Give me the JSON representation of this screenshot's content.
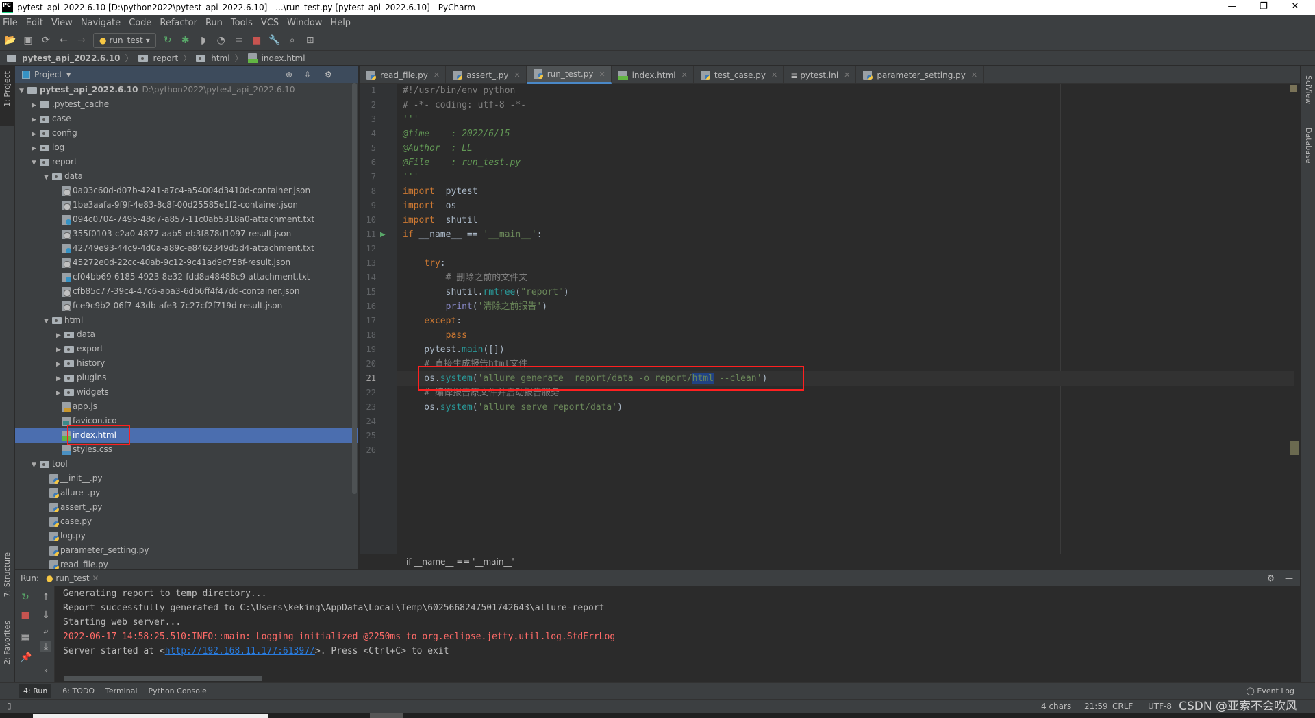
{
  "window": {
    "title": "pytest_api_2022.6.10 [D:\\python2022\\pytest_api_2022.6.10] - ...\\run_test.py [pytest_api_2022.6.10] - PyCharm",
    "logo": "PC"
  },
  "menu": [
    "File",
    "Edit",
    "View",
    "Navigate",
    "Code",
    "Refactor",
    "Run",
    "Tools",
    "VCS",
    "Window",
    "Help"
  ],
  "toolbar": {
    "run_config": "run_test"
  },
  "breadcrumb": [
    "pytest_api_2022.6.10",
    "report",
    "html",
    "index.html"
  ],
  "left_strip": {
    "project": "1: Project",
    "structure": "7: Structure",
    "favorites": "2: Favorites"
  },
  "right_strip": {
    "sciview": "SciView",
    "database": "Database"
  },
  "project": {
    "header": "Project",
    "tree": [
      {
        "label": "pytest_api_2022.6.10",
        "path": "D:\\python2022\\pytest_api_2022.6.10",
        "depth": 0,
        "type": "root",
        "open": true
      },
      {
        "label": ".pytest_cache",
        "depth": 1,
        "type": "folder",
        "open": false
      },
      {
        "label": "case",
        "depth": 1,
        "type": "folder",
        "open": false
      },
      {
        "label": "config",
        "depth": 1,
        "type": "folder",
        "open": false
      },
      {
        "label": "log",
        "depth": 1,
        "type": "folder",
        "open": false
      },
      {
        "label": "report",
        "depth": 1,
        "type": "folder",
        "open": true
      },
      {
        "label": "data",
        "depth": 2,
        "type": "folder",
        "open": true
      },
      {
        "label": "0a03c60d-d07b-4241-a7c4-a54004d3410d-container.json",
        "depth": 3,
        "type": "json"
      },
      {
        "label": "1be3aafa-9f9f-4e83-8c8f-00d25585e1f2-container.json",
        "depth": 3,
        "type": "json"
      },
      {
        "label": "094c0704-7495-48d7-a857-11c0ab5318a0-attachment.txt",
        "depth": 3,
        "type": "txt"
      },
      {
        "label": "355f0103-c2a0-4877-aab5-eb3f878d1097-result.json",
        "depth": 3,
        "type": "json"
      },
      {
        "label": "42749e93-44c9-4d0a-a89c-e8462349d5d4-attachment.txt",
        "depth": 3,
        "type": "txt"
      },
      {
        "label": "45272e0d-22cc-40ab-9c12-9c41ad9c758f-result.json",
        "depth": 3,
        "type": "json"
      },
      {
        "label": "cf04bb69-6185-4923-8e32-fdd8a48488c9-attachment.txt",
        "depth": 3,
        "type": "txt"
      },
      {
        "label": "cfb85c77-39c4-47c6-aba3-6db6ff4f47dd-container.json",
        "depth": 3,
        "type": "json"
      },
      {
        "label": "fce9c9b2-06f7-43db-afe3-7c27cf2f719d-result.json",
        "depth": 3,
        "type": "json"
      },
      {
        "label": "html",
        "depth": 2,
        "type": "folder",
        "open": true
      },
      {
        "label": "data",
        "depth": 3,
        "type": "folder",
        "open": false
      },
      {
        "label": "export",
        "depth": 3,
        "type": "folder",
        "open": false
      },
      {
        "label": "history",
        "depth": 3,
        "type": "folder",
        "open": false
      },
      {
        "label": "plugins",
        "depth": 3,
        "type": "folder",
        "open": false
      },
      {
        "label": "widgets",
        "depth": 3,
        "type": "folder",
        "open": false
      },
      {
        "label": "app.js",
        "depth": 3,
        "type": "js"
      },
      {
        "label": "favicon.ico",
        "depth": 3,
        "type": "ico"
      },
      {
        "label": "index.html",
        "depth": 3,
        "type": "html",
        "selected": true
      },
      {
        "label": "styles.css",
        "depth": 3,
        "type": "css"
      },
      {
        "label": "tool",
        "depth": 1,
        "type": "folder",
        "open": true
      },
      {
        "label": "__init__.py",
        "depth": 2,
        "type": "py"
      },
      {
        "label": "allure_.py",
        "depth": 2,
        "type": "py"
      },
      {
        "label": "assert_.py",
        "depth": 2,
        "type": "py"
      },
      {
        "label": "case.py",
        "depth": 2,
        "type": "py"
      },
      {
        "label": "log.py",
        "depth": 2,
        "type": "py"
      },
      {
        "label": "parameter_setting.py",
        "depth": 2,
        "type": "py"
      },
      {
        "label": "read_file.py",
        "depth": 2,
        "type": "py"
      }
    ]
  },
  "editor_tabs": [
    {
      "label": "read_file.py",
      "type": "py"
    },
    {
      "label": "assert_.py",
      "type": "py"
    },
    {
      "label": "run_test.py",
      "type": "py",
      "active": true
    },
    {
      "label": "index.html",
      "type": "html"
    },
    {
      "label": "test_case.py",
      "type": "py"
    },
    {
      "label": "pytest.ini",
      "type": "ini"
    },
    {
      "label": "parameter_setting.py",
      "type": "py"
    }
  ],
  "code": [
    [
      [
        "c",
        "#!/usr/bin/env python"
      ]
    ],
    [
      [
        "c",
        "# -*- coding: utf-8 -*-"
      ]
    ],
    [
      [
        "d",
        "'''"
      ]
    ],
    [
      [
        "d",
        "@time    : 2022/6/15"
      ]
    ],
    [
      [
        "d",
        "@Author  : LL"
      ]
    ],
    [
      [
        "d",
        "@File    : run_test.py"
      ]
    ],
    [
      [
        "d",
        "'''"
      ]
    ],
    [
      [
        "k",
        "import"
      ],
      [
        "",
        "  pytest"
      ]
    ],
    [
      [
        "k",
        "import"
      ],
      [
        "",
        "  os"
      ]
    ],
    [
      [
        "k",
        "import"
      ],
      [
        "",
        "  shutil"
      ]
    ],
    [
      [
        "k",
        "if"
      ],
      [
        "",
        " __name__ == "
      ],
      [
        "s",
        "'__main__'"
      ],
      [
        "",
        ":"
      ]
    ],
    [],
    [
      [
        "",
        "    "
      ],
      [
        "k",
        "try"
      ],
      [
        "",
        ":"
      ]
    ],
    [
      [
        "",
        "        "
      ],
      [
        "c",
        "# 删除之前的文件夹"
      ]
    ],
    [
      [
        "",
        "        shutil."
      ],
      [
        "f",
        "rmtree"
      ],
      [
        "",
        "("
      ],
      [
        "s",
        "\"report\""
      ],
      [
        "",
        ")"
      ]
    ],
    [
      [
        "",
        "        "
      ],
      [
        "b",
        "print"
      ],
      [
        "",
        "("
      ],
      [
        "s",
        "'清除之前报告'"
      ],
      [
        "",
        ")"
      ]
    ],
    [
      [
        "",
        "    "
      ],
      [
        "k",
        "except"
      ],
      [
        "",
        ":"
      ]
    ],
    [
      [
        "",
        "        "
      ],
      [
        "k",
        "pass"
      ]
    ],
    [
      [
        "",
        "    pytest."
      ],
      [
        "f",
        "main"
      ],
      [
        "",
        "([])"
      ]
    ],
    [
      [
        "",
        "    "
      ],
      [
        "c",
        "# 直接生成报告html文件"
      ]
    ],
    [
      [
        "",
        "    os."
      ],
      [
        "f",
        "system"
      ],
      [
        "",
        "("
      ],
      [
        "s",
        "'allure generate  report/data -o report/"
      ],
      [
        "s sel2",
        "html"
      ],
      [
        "s",
        " --clean'"
      ],
      [
        "",
        ")"
      ]
    ],
    [
      [
        "",
        "    "
      ],
      [
        "c",
        "# 编译报告原文件并启动报告服务"
      ]
    ],
    [
      [
        "",
        "    os."
      ],
      [
        "f",
        "system"
      ],
      [
        "",
        "("
      ],
      [
        "s",
        "'allure serve report/data'"
      ],
      [
        "",
        ")"
      ]
    ],
    [],
    [],
    []
  ],
  "current_line": 21,
  "editor_breadcrumb": "if __name__ == '__main__'",
  "run": {
    "label": "Run:",
    "tab": "run_test",
    "output": [
      {
        "text": "Generating report to temp directory...",
        "type": "normal"
      },
      {
        "text": "Report successfully generated to C:\\Users\\keking\\AppData\\Local\\Temp\\6025668247501742643\\allure-report",
        "type": "normal"
      },
      {
        "text": "Starting web server...",
        "type": "normal"
      },
      {
        "text": "2022-06-17 14:58:25.510:INFO::main: Logging initialized @2250ms to org.eclipse.jetty.util.log.StdErrLog",
        "type": "error"
      }
    ],
    "server_line": {
      "prefix": "Server started at <",
      "link": "http://192.168.11.177:61397/",
      "suffix": ">. Press <Ctrl+C> to exit"
    }
  },
  "bottom_tabs": [
    "4: Run",
    "6: TODO",
    "Terminal",
    "Python Console"
  ],
  "event_log": "Event Log",
  "status": {
    "chars": "4 chars",
    "position": "21:59",
    "line_sep": "CRLF",
    "encoding": "UTF-8"
  },
  "watermark": "CSDN @亚索不会吹风",
  "colors": {
    "selection": "#4b6eaf",
    "highlight_box": "#ff2020",
    "keyword": "#cc7832",
    "string": "#6a8759",
    "link": "#287bde",
    "error": "#ff6b68"
  }
}
